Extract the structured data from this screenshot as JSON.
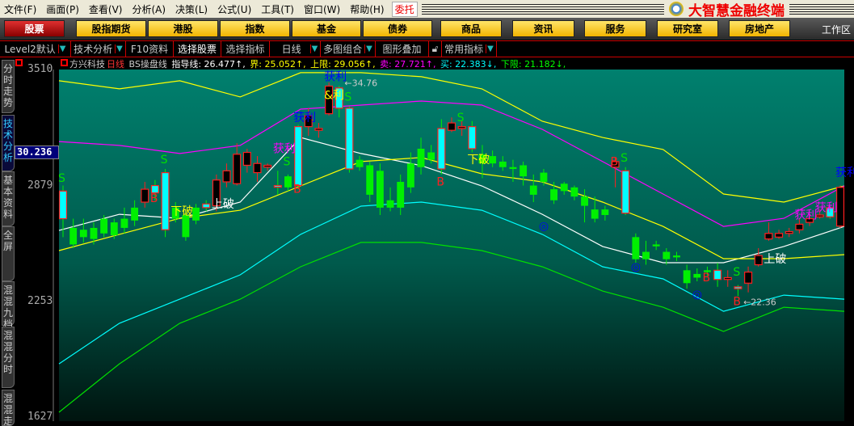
{
  "menu": [
    "文件(F)",
    "画面(P)",
    "查看(V)",
    "分析(A)",
    "决策(L)",
    "公式(U)",
    "工具(T)",
    "窗口(W)",
    "帮助(H)"
  ],
  "entrust": "委托",
  "brand": "大智慧金融终端",
  "nav": [
    "股票",
    "股指期货",
    "港股",
    "指数",
    "基金",
    "债券",
    "商品",
    "资讯",
    "服务",
    "研究室",
    "房地产"
  ],
  "workarea": "工作区",
  "toolbar": {
    "level2": "Level2默认",
    "tech": "技术分析",
    "f10": "F10资料",
    "select_stock": "选择股票",
    "select_index": "选择指标",
    "period": "日线",
    "multi": "多图组合",
    "overlay": "图形叠加",
    "common": "常用指标"
  },
  "info": {
    "stock": "方兴科技",
    "period": "日线",
    "indicator": "BS操盘线",
    "guide": "指导线: 26.477↑,",
    "jie": "界: 25.052↑,",
    "upper": "上限: 29.056↑,",
    "sell": "卖: 27.721↑,",
    "buy": "买: 22.383↓,",
    "lower": "下限: 21.182↓,"
  },
  "lefttabs": [
    "分时走势",
    "技术分析",
    "基本资料",
    "全屏",
    "混混九档",
    "混混分时",
    "混混走"
  ],
  "axis": {
    "labels": [
      "3510",
      "2879",
      "2253",
      "1627"
    ],
    "current": "30.236"
  },
  "colors": {
    "bg_top": "#00806e",
    "bg_bottom": "#00140f",
    "up": "#ff2020",
    "down": "#00f000",
    "cyan": "#00ffff"
  },
  "chart_data": {
    "type": "candlestick",
    "ylim": [
      1627,
      3510
    ],
    "candles": [
      [
        2700,
        2850,
        2880,
        2600,
        "c"
      ],
      [
        2650,
        2560,
        2700,
        2540,
        "g"
      ],
      [
        2600,
        2640,
        2700,
        2570,
        "g"
      ],
      [
        2650,
        2590,
        2680,
        2560,
        "g"
      ],
      [
        2620,
        2700,
        2720,
        2600,
        "g"
      ],
      [
        2680,
        2610,
        2700,
        2590,
        "g"
      ],
      [
        2650,
        2700,
        2760,
        2620,
        "g"
      ],
      [
        2760,
        2690,
        2800,
        2660,
        "g"
      ],
      [
        2790,
        2860,
        2900,
        2760,
        "r"
      ],
      [
        2880,
        2840,
        2910,
        2800,
        "c"
      ],
      [
        2950,
        2640,
        2970,
        2600,
        "c"
      ],
      [
        2700,
        2760,
        2790,
        2680,
        "g"
      ],
      [
        2720,
        2600,
        2740,
        2580,
        "g"
      ],
      [
        2690,
        2760,
        2780,
        2670,
        "g"
      ],
      [
        2760,
        2780,
        2800,
        2740,
        "c"
      ],
      [
        2770,
        2910,
        2940,
        2740,
        "r"
      ],
      [
        2900,
        2960,
        3000,
        2870,
        "r"
      ],
      [
        2890,
        3050,
        3110,
        2880,
        "r"
      ],
      [
        2990,
        3060,
        3080,
        2950,
        "r"
      ],
      [
        2950,
        3000,
        3040,
        2900,
        "r"
      ],
      [
        2980,
        2990,
        3000,
        2960,
        "r"
      ],
      [
        2880,
        2880,
        2960,
        2830,
        "c"
      ],
      [
        2870,
        2930,
        2940,
        2850,
        "g"
      ],
      [
        2880,
        3200,
        3210,
        2860,
        "c"
      ],
      [
        3200,
        3260,
        3300,
        3150,
        "r"
      ],
      [
        3180,
        3190,
        3220,
        3140,
        "r"
      ],
      [
        3270,
        3420,
        3440,
        3260,
        "r"
      ],
      [
        3410,
        3300,
        3420,
        3250,
        "c"
      ],
      [
        3300,
        2970,
        3310,
        2950,
        "c"
      ],
      [
        2980,
        3020,
        3040,
        2960,
        "g"
      ],
      [
        2990,
        2830,
        3010,
        2790,
        "g"
      ],
      [
        2960,
        2760,
        3000,
        2720,
        "g"
      ],
      [
        2800,
        2760,
        2870,
        2740,
        "g"
      ],
      [
        2900,
        2760,
        2940,
        2720,
        "g"
      ],
      [
        3000,
        2870,
        3060,
        2840,
        "g"
      ],
      [
        3080,
        2980,
        3140,
        2940,
        "g"
      ],
      [
        3060,
        3020,
        3100,
        3000,
        "g"
      ],
      [
        2970,
        3190,
        3240,
        2940,
        "c"
      ],
      [
        3180,
        3220,
        3250,
        3170,
        "r"
      ],
      [
        3190,
        3200,
        3230,
        3150,
        "r"
      ],
      [
        3200,
        3080,
        3230,
        3060,
        "c"
      ],
      [
        3000,
        3050,
        3100,
        2920,
        "g"
      ],
      [
        3040,
        3000,
        3070,
        2980,
        "g"
      ],
      [
        3010,
        2980,
        3040,
        2960,
        "g"
      ],
      [
        2980,
        2970,
        3020,
        2900,
        "g"
      ],
      [
        2990,
        2930,
        3010,
        2880,
        "g"
      ],
      [
        2880,
        2830,
        2940,
        2790,
        "g"
      ],
      [
        2950,
        2900,
        2970,
        2880,
        "g"
      ],
      [
        2860,
        2800,
        2900,
        2780,
        "g"
      ],
      [
        2850,
        2890,
        2900,
        2830,
        "g"
      ],
      [
        2820,
        2870,
        2880,
        2800,
        "g"
      ],
      [
        2820,
        2770,
        2860,
        2680,
        "g"
      ],
      [
        2750,
        2700,
        2820,
        2680,
        "g"
      ],
      [
        2720,
        2750,
        2770,
        2690,
        "g"
      ],
      [
        2980,
        3010,
        3030,
        2870,
        "r"
      ],
      [
        2960,
        2730,
        2980,
        2720,
        "c"
      ],
      [
        2600,
        2480,
        2620,
        2460,
        "g"
      ],
      [
        2520,
        2480,
        2580,
        2450,
        "g"
      ],
      [
        2550,
        2560,
        2580,
        2530,
        "g"
      ],
      [
        2520,
        2480,
        2540,
        2450,
        "g"
      ],
      [
        2500,
        2490,
        2520,
        2470,
        "g"
      ],
      [
        2420,
        2350,
        2450,
        2320,
        "g"
      ],
      [
        2380,
        2400,
        2430,
        2360,
        "g"
      ],
      [
        2420,
        2410,
        2440,
        2390,
        "g"
      ],
      [
        2420,
        2370,
        2460,
        2330,
        "c"
      ],
      [
        2370,
        2380,
        2420,
        2330,
        "r"
      ],
      [
        2320,
        2330,
        2340,
        2280,
        "c"
      ],
      [
        2350,
        2410,
        2440,
        2300,
        "r"
      ],
      [
        2450,
        2500,
        2540,
        2440,
        "r"
      ],
      [
        2590,
        2620,
        2680,
        2580,
        "r"
      ],
      [
        2600,
        2620,
        2640,
        2590,
        "r"
      ],
      [
        2620,
        2630,
        2650,
        2600,
        "r"
      ],
      [
        2640,
        2670,
        2700,
        2620,
        "r"
      ],
      [
        2680,
        2700,
        2720,
        2660,
        "r"
      ],
      [
        2710,
        2720,
        2750,
        2700,
        "r"
      ],
      [
        2710,
        2760,
        2770,
        2700,
        "c"
      ],
      [
        2660,
        2870,
        2880,
        2650,
        "r"
      ]
    ],
    "bands": [
      {
        "name": "upper",
        "color": "#ffff00",
        "values": [
          3449,
          3405,
          3449,
          3361,
          3493,
          3493,
          3471,
          3405,
          3229,
          3141,
          3076,
          2834,
          2790,
          2878
        ]
      },
      {
        "name": "sell",
        "color": "#ff00ff",
        "values": [
          3119,
          3098,
          3054,
          3098,
          3295,
          3317,
          3339,
          3317,
          3185,
          3010,
          2834,
          2658,
          2702,
          2878
        ]
      },
      {
        "name": "guide",
        "color": "#ffffff",
        "values": [
          2636,
          2724,
          2702,
          2790,
          3141,
          3054,
          2988,
          2878,
          2724,
          2549,
          2461,
          2461,
          2549,
          2658
        ]
      },
      {
        "name": "jie",
        "color": "#ffff00",
        "values": [
          2527,
          2615,
          2702,
          2746,
          2878,
          3010,
          3032,
          2944,
          2900,
          2790,
          2658,
          2483,
          2483,
          2505
        ]
      },
      {
        "name": "buy",
        "color": "#00ffff",
        "values": [
          1912,
          2132,
          2263,
          2395,
          2615,
          2768,
          2790,
          2746,
          2615,
          2439,
          2373,
          2197,
          2285,
          2263
        ]
      },
      {
        "name": "lower",
        "color": "#00e000",
        "values": [
          1649,
          1912,
          2132,
          2263,
          2439,
          2571,
          2571,
          2527,
          2439,
          2307,
          2219,
          2088,
          2219,
          2197
        ]
      }
    ],
    "annotations": [
      {
        "i": 0,
        "p": 2900,
        "text": "S",
        "color": "#00e000"
      },
      {
        "i": 10,
        "p": 3000,
        "text": "S",
        "color": "#00e000"
      },
      {
        "i": 9,
        "p": 2790,
        "text": "B",
        "color": "#ff2020"
      },
      {
        "i": 11,
        "p": 2720,
        "text": "下破",
        "color": "#ffff00"
      },
      {
        "i": 15,
        "p": 2760,
        "text": "上破",
        "color": "#ffffff"
      },
      {
        "i": 21,
        "p": 3060,
        "text": "获利",
        "color": "#ff00ff"
      },
      {
        "i": 22,
        "p": 2990,
        "text": "S",
        "color": "#00e000"
      },
      {
        "i": 23,
        "p": 2840,
        "text": "B",
        "color": "#ff2020"
      },
      {
        "i": 23,
        "p": 3230,
        "text": "获利",
        "color": "#0000ff"
      },
      {
        "i": 26,
        "p": 3350,
        "text": "&利",
        "color": "#ffff00"
      },
      {
        "i": 26,
        "p": 3450,
        "text": "获利",
        "color": "#0000ff"
      },
      {
        "i": 28,
        "p": 3420,
        "text": "←34.76",
        "color": "#cccccc"
      },
      {
        "i": 28,
        "p": 3340,
        "text": "S",
        "color": "#00e000"
      },
      {
        "i": 37,
        "p": 2880,
        "text": "B",
        "color": "#ff2020"
      },
      {
        "i": 39,
        "p": 3230,
        "text": "S",
        "color": "#00e000"
      },
      {
        "i": 40,
        "p": 3000,
        "text": "下破",
        "color": "#ffff00"
      },
      {
        "i": 47,
        "p": 2640,
        "text": "◎",
        "color": "#0000ff"
      },
      {
        "i": 54,
        "p": 2990,
        "text": "B",
        "color": "#ff2020"
      },
      {
        "i": 55,
        "p": 3010,
        "text": "S",
        "color": "#00e000"
      },
      {
        "i": 56,
        "p": 2420,
        "text": "◎",
        "color": "#0000ff"
      },
      {
        "i": 62,
        "p": 2270,
        "text": "◎",
        "color": "#0000ff"
      },
      {
        "i": 63,
        "p": 2360,
        "text": "B",
        "color": "#ff2020"
      },
      {
        "i": 66,
        "p": 2390,
        "text": "S",
        "color": "#00e000"
      },
      {
        "i": 66,
        "p": 2230,
        "text": "B",
        "color": "#ff2020"
      },
      {
        "i": 67,
        "p": 2230,
        "text": "←22.36",
        "color": "#cccccc"
      },
      {
        "i": 69,
        "p": 2460,
        "text": "上破",
        "color": "#ffffff"
      },
      {
        "i": 72,
        "p": 2700,
        "text": "获利",
        "color": "#ff00ff"
      },
      {
        "i": 74,
        "p": 2740,
        "text": "获利",
        "color": "#ff00ff"
      },
      {
        "i": 76,
        "p": 2930,
        "text": "获利",
        "color": "#0000ff"
      }
    ]
  }
}
